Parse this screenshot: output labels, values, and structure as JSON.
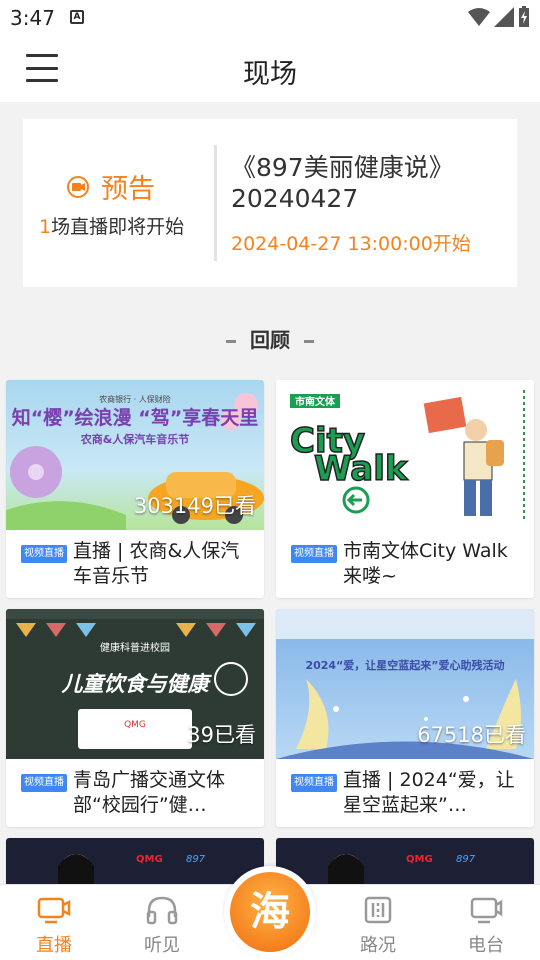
{
  "status_bar": {
    "time": "3:47"
  },
  "header": {
    "title": "现场"
  },
  "preview": {
    "badge": "预告",
    "count_num": "1",
    "count_text": "场直播即将开始",
    "title": "《897美丽健康说》20240427",
    "time": "2024-04-27 13:00:00开始"
  },
  "review": {
    "heading": "回顾"
  },
  "cards": [
    {
      "views": "303149已看",
      "tag": "视频直播",
      "title": "直播 | 农商&人保汽车音乐节",
      "thumb_text": "知“樱”绘浪漫 “驾”享春天里",
      "thumb_sub": "农商&人保汽车音乐节"
    },
    {
      "views": "",
      "tag": "视频直播",
      "title": "市南文体City Walk来喽~",
      "thumb_text": "City Walk",
      "thumb_sub": "市南文体"
    },
    {
      "views": "39已看",
      "tag": "视频直播",
      "title": "青岛广播交通文体部“校园行”健…",
      "thumb_text": "儿童饮食与健康",
      "thumb_sub": "健康科普进校园"
    },
    {
      "views": "67518已看",
      "tag": "视频直播",
      "title": "直播 | 2024“爱，让星空蓝起来”…",
      "thumb_text": "2024“爱，让星空蓝起来”爱心助残活动",
      "thumb_sub": ""
    },
    {
      "views": "",
      "tag": "",
      "title": "",
      "thumb_text": "",
      "thumb_sub": ""
    },
    {
      "views": "",
      "tag": "",
      "title": "",
      "thumb_text": "",
      "thumb_sub": ""
    }
  ],
  "nav": [
    {
      "label": "直播",
      "icon": "tv-icon"
    },
    {
      "label": "听见",
      "icon": "headphones-icon"
    },
    {
      "label": "海",
      "icon": "sea-logo"
    },
    {
      "label": "路况",
      "icon": "road-icon"
    },
    {
      "label": "电台",
      "icon": "radio-icon"
    }
  ],
  "colors": {
    "accent": "#f5821f",
    "tag_blue": "#3f87f5"
  }
}
